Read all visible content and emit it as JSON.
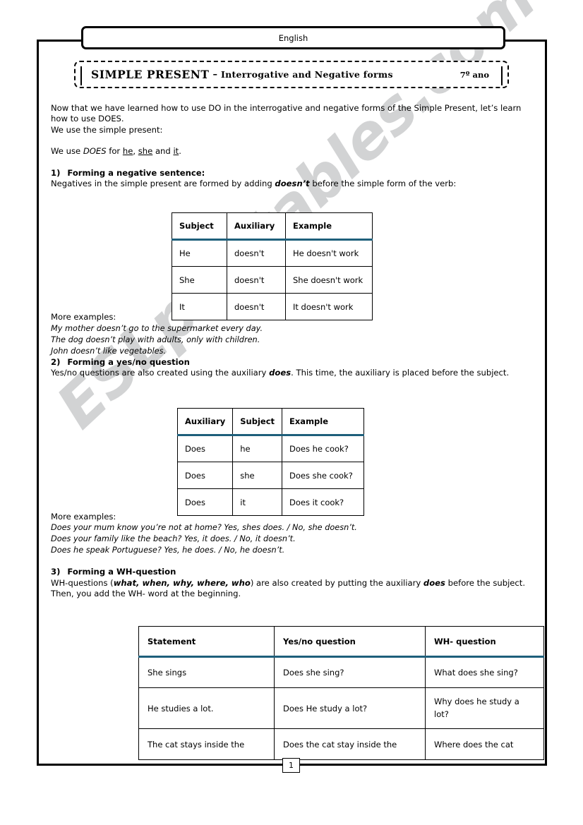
{
  "watermark": {
    "text": "ESLprintables.com",
    "color": "#d2d3d4"
  },
  "header": {
    "subject": "English",
    "title_main": "SIMPLE PRESENT",
    "title_dash": "–",
    "title_sub": "Interrogative and Negative forms",
    "grade": "7º ano"
  },
  "footer": {
    "page_number": "1"
  },
  "intro": {
    "line1": "Now that we have learned how to use DO in the interrogative and negative forms of the Simple Present, let’s learn how to use DOES.",
    "line2": "We use the simple present:",
    "line3_pre": "We use ",
    "line3_does": "DOES",
    "line3_mid": " for ",
    "line3_he": "he",
    "line3_comma": ", ",
    "line3_she": "she",
    "line3_and": " and ",
    "line3_it": "it",
    "line3_end": "."
  },
  "section1": {
    "number": "1)",
    "heading": "Forming a negative sentence:",
    "body_pre": "Negatives in the simple present are formed by adding  ",
    "body_bold": "doesn’t",
    "body_post": " before the simple form of the verb:"
  },
  "table1": {
    "headers": [
      "Subject",
      "Auxiliary",
      "Example"
    ],
    "rows": [
      [
        "He",
        "doesn't",
        "He doesn't work"
      ],
      [
        "She",
        "doesn't",
        "She doesn't work"
      ],
      [
        "It",
        "doesn't",
        "It doesn't work"
      ]
    ]
  },
  "examples1": {
    "label": "More examples:",
    "lines": [
      "My mother doesn’t go to the supermarket every day.",
      "The dog doesn’t play with adults, only with children.",
      "John doesn’t like vegetables."
    ]
  },
  "section2": {
    "number": "2)",
    "heading": "Forming a yes/no question",
    "body_pre": "Yes/no questions are also created using the auxiliary ",
    "body_bold": "does",
    "body_post": ". This time, the auxiliary is placed before the subject."
  },
  "table2": {
    "headers": [
      "Auxiliary",
      "Subject",
      "Example"
    ],
    "rows": [
      [
        "Does",
        "he",
        "Does he cook?"
      ],
      [
        "Does",
        "she",
        "Does she cook?"
      ],
      [
        "Does",
        "it",
        "Does it cook?"
      ]
    ]
  },
  "examples2": {
    "label": "More examples:",
    "lines": [
      "Does your mum know you’re not at home? Yes, shes does. / No, she doesn’t.",
      "Does your family like the beach? Yes, it does. / No, it doesn’t.",
      "Does he speak Portuguese? Yes, he does. / No, he doesn’t."
    ]
  },
  "section3": {
    "number": "3)",
    "heading": "Forming a WH-question",
    "body_pre": "WH-questions (",
    "body_words": "what, when, why, where, who",
    "body_mid": ") are also created by putting the auxiliary ",
    "body_bold": "does",
    "body_post": " before the subject. Then, you add the WH- word at the beginning."
  },
  "table3": {
    "headers": [
      "Statement",
      "Yes/no question",
      "WH- question"
    ],
    "rows": [
      [
        "She sings",
        "Does she sing?",
        "What does she sing?"
      ],
      [
        "He studies a lot.",
        "Does He study a lot?",
        "Why does he study a lot?"
      ],
      [
        "The cat stays inside the",
        "Does the cat stay inside the",
        "Where does the cat"
      ]
    ]
  },
  "colors": {
    "table_header_rule": "#1e5f7b",
    "frame": "#000000"
  }
}
